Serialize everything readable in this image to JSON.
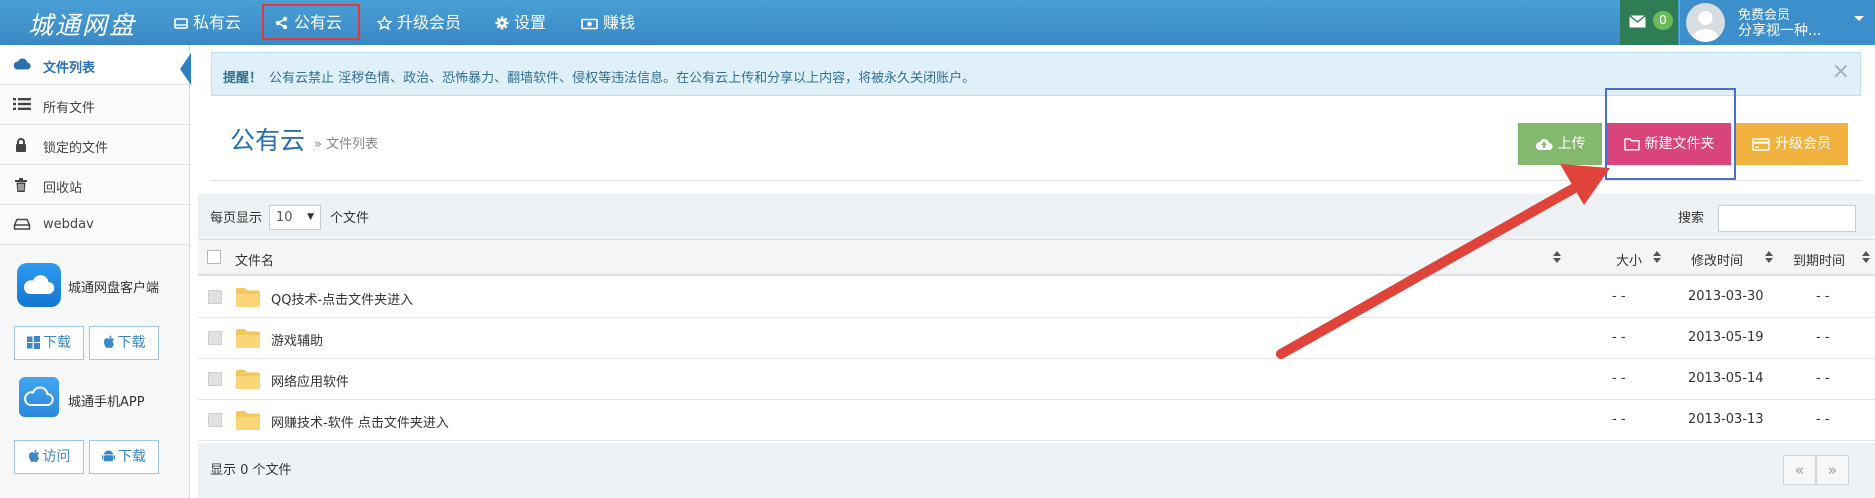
{
  "navbar": {
    "brand": "城通网盘",
    "items": [
      {
        "label": "私有云",
        "icon": "drive-icon"
      },
      {
        "label": "公有云",
        "icon": "share-icon"
      },
      {
        "label": "升级会员",
        "icon": "star-icon"
      },
      {
        "label": "设置",
        "icon": "gear-icon"
      },
      {
        "label": "赚钱",
        "icon": "money-icon"
      }
    ],
    "messages_count": "0",
    "user": {
      "level": "免费会员",
      "name": "分享视一种..."
    }
  },
  "sidebar": {
    "items": [
      {
        "label": "文件列表",
        "icon": "cloud-icon",
        "active": true
      },
      {
        "label": "所有文件",
        "icon": "list-icon"
      },
      {
        "label": "锁定的文件",
        "icon": "lock-icon"
      },
      {
        "label": "回收站",
        "icon": "trash-icon"
      },
      {
        "label": "webdav",
        "icon": "hdd-icon"
      }
    ],
    "clients": [
      {
        "label": "城通网盘客户端",
        "icon": "cloud-app-icon",
        "buttons": [
          {
            "label": "下载",
            "icon": "windows-icon"
          },
          {
            "label": "下载",
            "icon": "apple-icon"
          }
        ]
      },
      {
        "label": "城通手机APP",
        "icon": "mobile-cloud-icon",
        "buttons": [
          {
            "label": "访问",
            "icon": "apple-icon"
          },
          {
            "label": "下载",
            "icon": "android-icon"
          }
        ]
      }
    ]
  },
  "alert": {
    "bold": "提醒！",
    "text": "公有云禁止 淫秽色情、政治、恐怖暴力、翻墙软件、侵权等违法信息。在公有云上传和分享以上内容，将被永久关闭账户。",
    "close": "×"
  },
  "page": {
    "title": "公有云",
    "crumb": "» 文件列表"
  },
  "actions": {
    "upload": "上传",
    "new_folder": "新建文件夹",
    "upgrade": "升级会员"
  },
  "table": {
    "per_page_prefix": "每页显示",
    "per_page_value": "10",
    "per_page_suffix": "个文件",
    "search_label": "搜索",
    "search_value": "",
    "columns": {
      "name": "文件名",
      "size": "大小",
      "modified": "修改时间",
      "expires": "到期时间"
    },
    "rows": [
      {
        "name": "QQ技术-点击文件夹进入",
        "size": "- -",
        "modified": "2013-03-30",
        "expires": "- -"
      },
      {
        "name": "游戏辅助",
        "size": "- -",
        "modified": "2013-05-19",
        "expires": "- -"
      },
      {
        "name": "网络应用软件",
        "size": "- -",
        "modified": "2013-05-14",
        "expires": "- -"
      },
      {
        "name": "网赚技术-软件 点击文件夹进入",
        "size": "- -",
        "modified": "2013-03-13",
        "expires": "- -"
      }
    ],
    "footer": "显示 0 个文件",
    "pager_prev": "«",
    "pager_next": "»"
  },
  "colors": {
    "navbar": "#4a9fd6",
    "new_folder": "#d9447b",
    "upload": "#83b86e",
    "upgrade": "#f2b23f",
    "arrow": "#e0433a"
  }
}
